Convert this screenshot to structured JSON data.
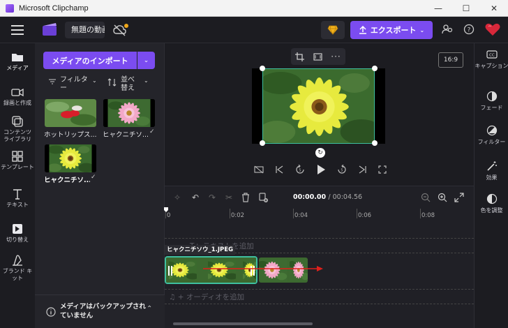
{
  "window": {
    "title": "Microsoft Clipchamp",
    "controls": [
      "—",
      "☐",
      "✕"
    ]
  },
  "header": {
    "project_name": "無題の動画",
    "export_label": "エクスポート",
    "export_icon": "upload-icon",
    "premium_icon": "diamond-icon"
  },
  "left_rail": [
    {
      "label": "メディア",
      "icon": "folder-icon"
    },
    {
      "label": "録画と作成",
      "icon": "camera-icon"
    },
    {
      "label": "コンテンツ ライブラリ",
      "icon": "library-icon"
    },
    {
      "label": "テンプレート",
      "icon": "template-icon"
    },
    {
      "label": "テキスト",
      "icon": "text-icon"
    },
    {
      "label": "切り替え",
      "icon": "transition-icon"
    },
    {
      "label": "ブランド キット",
      "icon": "brand-kit-icon"
    }
  ],
  "media": {
    "import_label": "メディアのインポート",
    "filter_label": "フィルター",
    "sort_label": "並べ替え",
    "items": [
      {
        "label": "ホットリップス...",
        "checked": false
      },
      {
        "label": "ヒャクニチソ...",
        "checked": true
      },
      {
        "label": "ヒャクニチソ...",
        "checked": true
      }
    ],
    "backup_note": "メディアはバックアップされていません"
  },
  "preview": {
    "aspect": "16:9"
  },
  "timeline": {
    "current_time": "00:00.00",
    "duration": "/ 00:04.56",
    "ruler": [
      "0",
      "0:02",
      "0:04",
      "0:06",
      "0:08"
    ],
    "text_track_placeholder": "テキストを追加",
    "clip_label": "ヒャクニチソウ_1.JPEG",
    "audio_track_placeholder": "オーディオを追加"
  },
  "right_rail": [
    {
      "label": "キャプション",
      "icon": "captions-icon"
    },
    {
      "label": "フェード",
      "icon": "fade-icon"
    },
    {
      "label": "フィルター",
      "icon": "filter-icon"
    },
    {
      "label": "効果",
      "icon": "magic-wand-icon"
    },
    {
      "label": "色を調整",
      "icon": "color-adjust-icon"
    }
  ],
  "colors": {
    "accent": "#7b4cf0",
    "selection": "#3fbf9f",
    "arrow": "#e0201c"
  }
}
